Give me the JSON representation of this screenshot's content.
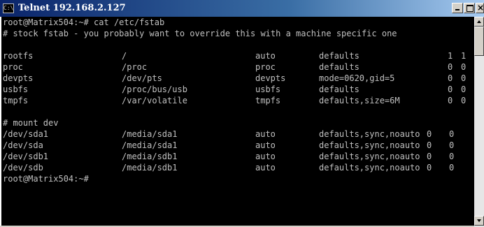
{
  "window": {
    "title": "Telnet 192.168.2.127",
    "icon": "console-icon",
    "icon_glyph": "C:\\",
    "colors": {
      "titlebar": "#0a246a",
      "console_bg": "#000000",
      "console_fg": "#c0c0c0"
    }
  },
  "terminal": {
    "prompt_command": "root@Matrix504:~# cat /etc/fstab",
    "comment": "# stock fstab - you probably want to override this with a machine specific one",
    "fstab_rows": [
      [
        "rootfs",
        "/",
        "auto",
        "defaults",
        "1",
        "1"
      ],
      [
        "proc",
        "/proc",
        "proc",
        "defaults",
        "0",
        "0"
      ],
      [
        "devpts",
        "/dev/pts",
        "devpts",
        "mode=0620,gid=5",
        "0",
        "0"
      ],
      [
        "usbfs",
        "/proc/bus/usb",
        "usbfs",
        "defaults",
        "0",
        "0"
      ],
      [
        "tmpfs",
        "/var/volatile",
        "tmpfs",
        "defaults,size=6M",
        "0",
        "0"
      ]
    ],
    "mount_comment": "# mount dev",
    "mount_rows": [
      [
        "/dev/sda1",
        "/media/sda1",
        "auto",
        "defaults,sync,noauto",
        "0",
        "0"
      ],
      [
        "/dev/sda",
        "/media/sda1",
        "auto",
        "defaults,sync,noauto",
        "0",
        "0"
      ],
      [
        "/dev/sdb1",
        "/media/sdb1",
        "auto",
        "defaults,sync,noauto",
        "0",
        "0"
      ],
      [
        "/dev/sdb",
        "/media/sdb1",
        "auto",
        "defaults,sync,noauto",
        "0",
        "0"
      ]
    ],
    "final_prompt": "root@Matrix504:~#"
  }
}
